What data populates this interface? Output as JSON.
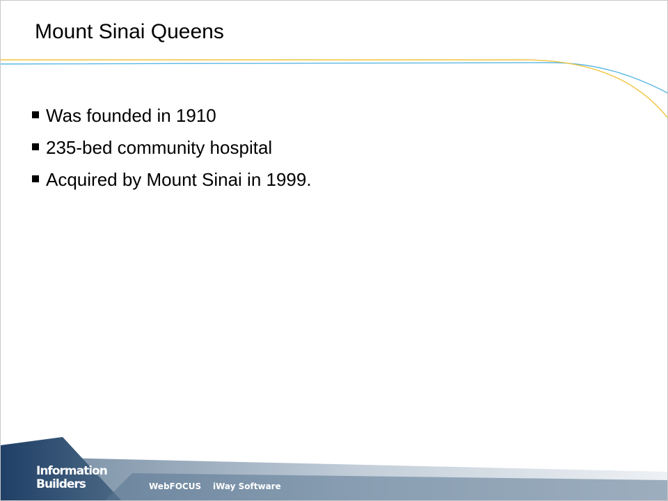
{
  "slide": {
    "title": "Mount Sinai Queens",
    "bullets": [
      "Was founded in 1910",
      "235-bed community hospital",
      "Acquired by Mount Sinai in 1999."
    ]
  },
  "footer": {
    "logo_line_1": "Information",
    "logo_line_2": "Builders",
    "products": [
      "WebFOCUS",
      "iWay Software"
    ]
  },
  "colors": {
    "swoosh_blue": "#5bb8e3",
    "swoosh_gold": "#f0c43c",
    "footer_dark": "#1f3f66",
    "footer_mid": "#5a7691",
    "footer_light": "#a4b5c6"
  }
}
